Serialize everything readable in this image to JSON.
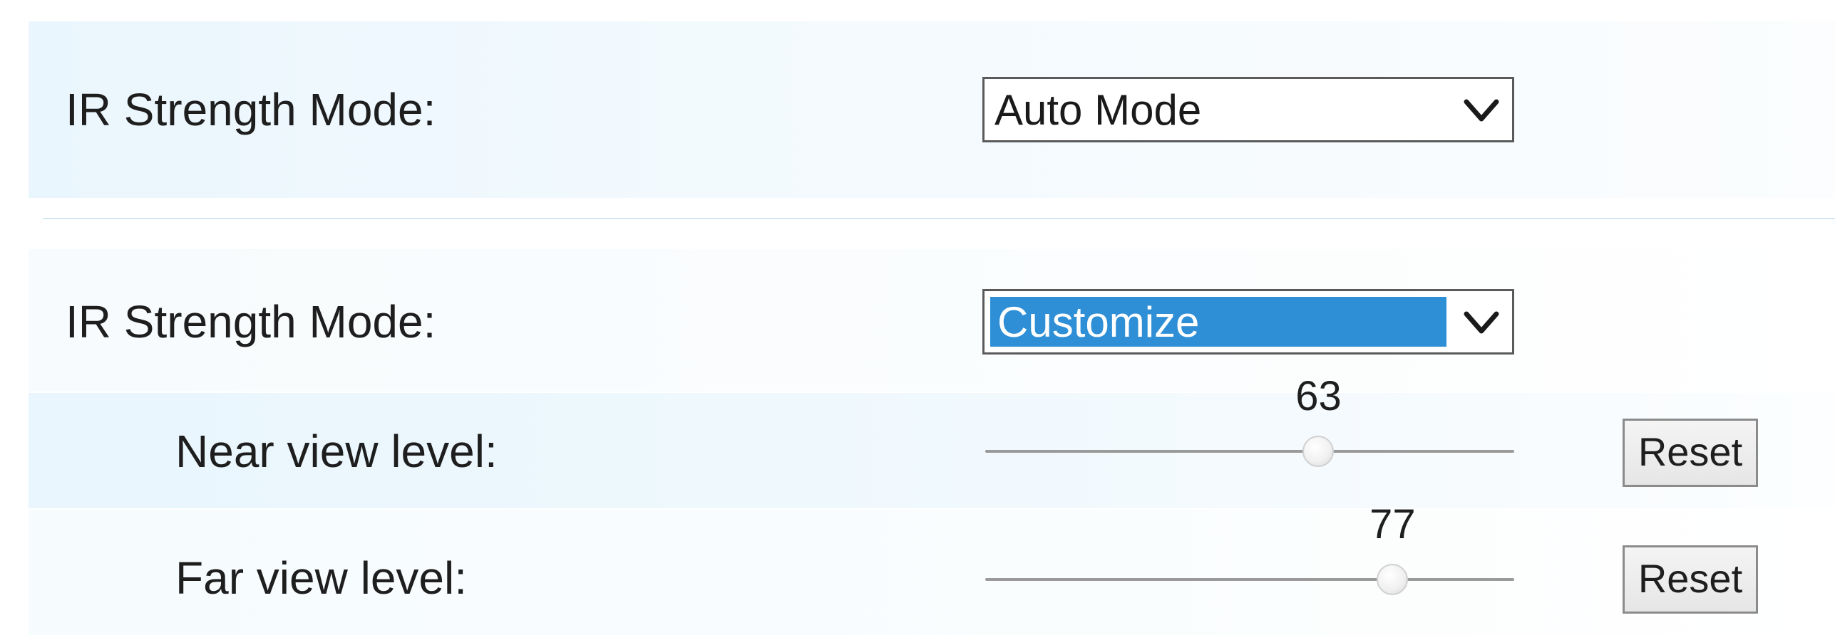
{
  "ir_auto": {
    "label": "IR Strength Mode:",
    "select_value": "Auto Mode"
  },
  "ir_custom": {
    "label": "IR Strength Mode:",
    "select_value": "Customize",
    "highlight_color": "#2f8fd6"
  },
  "near_view": {
    "label": "Near view level:",
    "value": "63",
    "level": 63,
    "reset_label": "Reset"
  },
  "far_view": {
    "label": "Far view level:",
    "value": "77",
    "level": 77,
    "reset_label": "Reset"
  }
}
